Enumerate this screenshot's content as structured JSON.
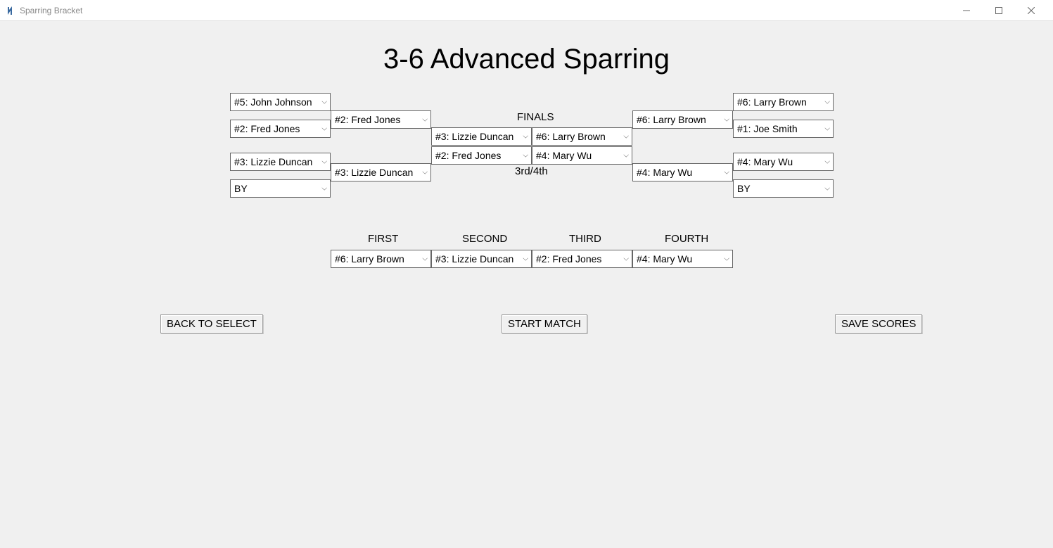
{
  "window": {
    "title": "Sparring Bracket"
  },
  "page": {
    "title": "3-6 Advanced Sparring"
  },
  "labels": {
    "finals": "FINALS",
    "third_fourth": "3rd/4th",
    "first": "FIRST",
    "second": "SECOND",
    "third": "THIRD",
    "fourth": "FOURTH"
  },
  "bracket": {
    "left_r1": {
      "slot1": "#5: John Johnson",
      "slot2": "#2: Fred Jones",
      "slot3": "#3: Lizzie Duncan",
      "slot4": "BY"
    },
    "left_r2": {
      "slot1": "#2: Fred Jones",
      "slot2": "#3: Lizzie Duncan"
    },
    "finals": {
      "left": "#3: Lizzie Duncan",
      "right": "#6: Larry Brown"
    },
    "third_match": {
      "left": "#2: Fred Jones",
      "right": "#4: Mary Wu"
    },
    "right_r2": {
      "slot1": "#6: Larry Brown",
      "slot2": "#4: Mary Wu"
    },
    "right_r1": {
      "slot1": "#6: Larry Brown",
      "slot2": "#1: Joe Smith",
      "slot3": "#4: Mary Wu",
      "slot4": "BY"
    }
  },
  "results": {
    "first": "#6: Larry Brown",
    "second": "#3: Lizzie Duncan",
    "third": "#2: Fred Jones",
    "fourth": "#4: Mary Wu"
  },
  "buttons": {
    "back": "BACK TO SELECT",
    "start": "START MATCH",
    "save": "SAVE SCORES"
  }
}
